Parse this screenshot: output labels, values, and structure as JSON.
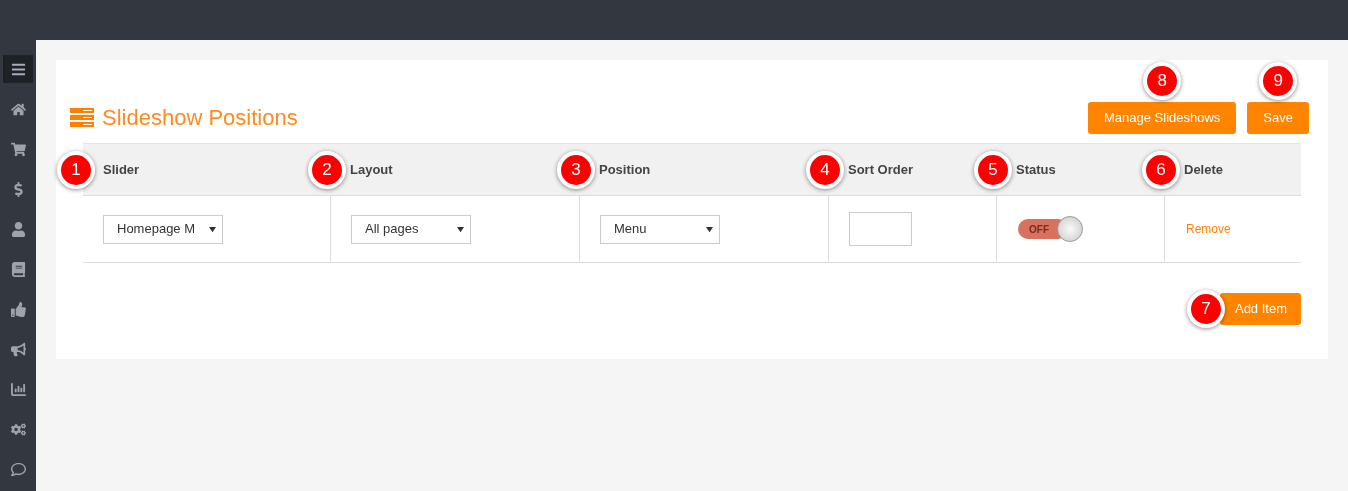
{
  "sidebar": {
    "items": [
      {
        "kind": "menu",
        "selected": true
      },
      {
        "kind": "home",
        "selected": false
      },
      {
        "kind": "cart",
        "selected": false
      },
      {
        "kind": "dollar",
        "selected": false
      },
      {
        "kind": "user",
        "selected": false
      },
      {
        "kind": "book",
        "selected": false
      },
      {
        "kind": "thumb",
        "selected": false
      },
      {
        "kind": "bullhorn",
        "selected": false
      },
      {
        "kind": "chart",
        "selected": false
      },
      {
        "kind": "cogs",
        "selected": false
      },
      {
        "kind": "comment",
        "selected": false
      }
    ]
  },
  "page": {
    "title": "Slideshow Positions",
    "buttons": [
      {
        "label": "Manage Slideshows",
        "marker": "8"
      },
      {
        "label": "Save",
        "marker": "9"
      }
    ]
  },
  "table": {
    "columns": [
      {
        "label": "Slider",
        "marker": "1"
      },
      {
        "label": "Layout",
        "marker": "2"
      },
      {
        "label": "Position",
        "marker": "3"
      },
      {
        "label": "Sort Order",
        "marker": "4"
      },
      {
        "label": "Status",
        "marker": "5"
      },
      {
        "label": "Delete",
        "marker": "6"
      }
    ],
    "rows": [
      {
        "slider": "Homepage M",
        "layout": "All pages",
        "position": "Menu",
        "status": {
          "label": "OFF",
          "on": false
        },
        "delete": "Remove"
      }
    ]
  },
  "add_button": {
    "label": "Add Item",
    "marker": "7"
  }
}
